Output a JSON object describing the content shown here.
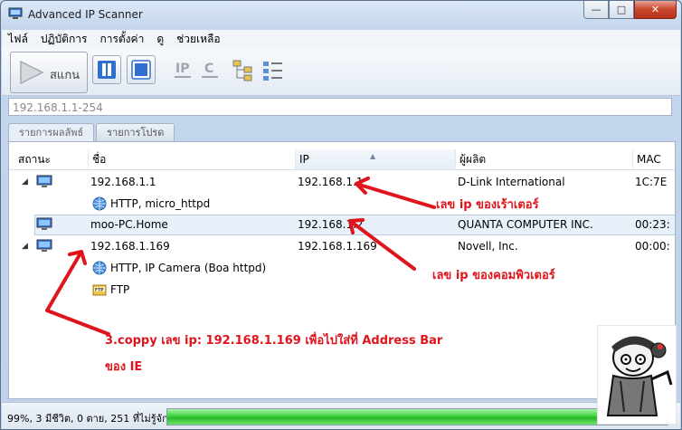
{
  "window": {
    "title": "Advanced IP Scanner",
    "minimize": "—",
    "maximize": "□",
    "close": "✕"
  },
  "menu": [
    "ไฟล์",
    "ปฏิบัติการ",
    "การตั้งค่า",
    "ดู",
    "ช่วยเหลือ"
  ],
  "toolbar": {
    "scan_label": "สแกน",
    "icons": [
      "play-icon",
      "pause-icon",
      "stop-icon",
      "ip-icon",
      "c-class-icon",
      "network-tree-icon",
      "list-view-icon"
    ]
  },
  "address": {
    "value": "192.168.1.1-254"
  },
  "tabs": [
    {
      "label": "รายการผลลัพธ์"
    },
    {
      "label": "รายการโปรด"
    }
  ],
  "columns": {
    "status": "สถานะ",
    "name": "ชื่อ",
    "ip": "IP",
    "maker": "ผู้ผลิต",
    "mac": "MAC"
  },
  "rows": [
    {
      "name": "192.168.1.1",
      "ip": "192.168.1.1",
      "maker": "D-Link International",
      "mac": "1C:7E"
    },
    {
      "service": "HTTP, micro_httpd"
    },
    {
      "name": "moo-PC.Home",
      "ip": "192.168.1.2",
      "maker": "QUANTA COMPUTER INC.",
      "mac": "00:23:"
    },
    {
      "name": "192.168.1.169",
      "ip": "192.168.1.169",
      "maker": "Novell, Inc.",
      "mac": "00:00:"
    },
    {
      "service": "HTTP, IP Camera (Boa httpd)"
    },
    {
      "service": "FTP"
    }
  ],
  "annotations": {
    "router": "เลข   ip ของเร้าเตอร์",
    "computer": "เลข   ip ของคอมพิวเตอร์",
    "copy_line1": "3.coppy เลข   ip: 192.168.1.169 เพื่อไปใส่ที่   Address Bar",
    "copy_line2": "ของ   IE"
  },
  "status": {
    "text": "99%, 3 มีชีวิต, 0 ตาย, 251 ที่ไม่รู้จัก",
    "progress_fraction": 0.99
  },
  "colors": {
    "annotation": "#e0141c",
    "progress": "#3fd23f",
    "selection": "#e8f0fa"
  }
}
